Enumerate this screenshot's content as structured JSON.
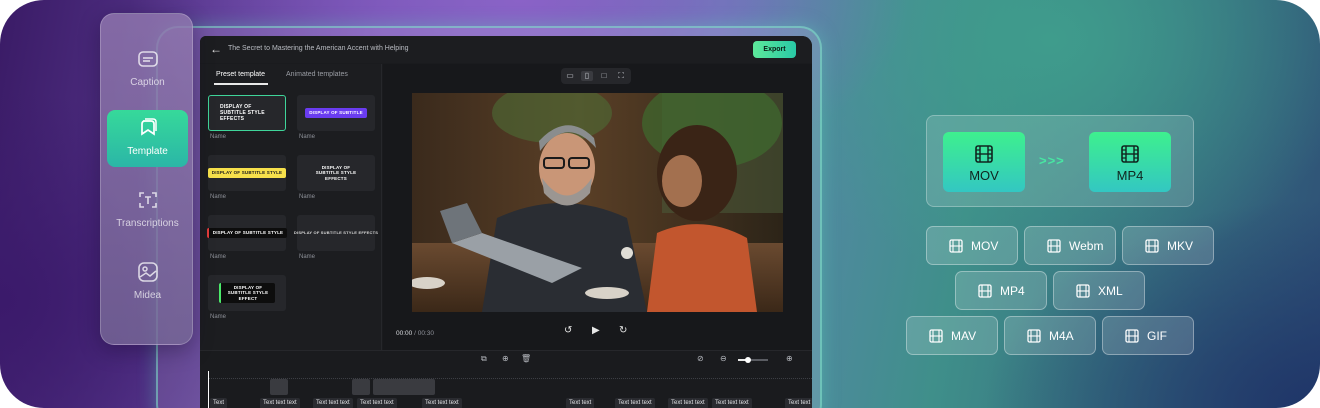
{
  "editor": {
    "title": "The Secret to Mastering the American Accent with Helping",
    "export_label": "Export",
    "tabs": [
      "Preset template",
      "Animated templates"
    ],
    "templates": [
      {
        "text": "DISPLAY OF SUBTITLE STYLE EFFECTS",
        "name": "Name"
      },
      {
        "text": "DISPLAY OF SUBTITLE",
        "name": "Name"
      },
      {
        "text": "DISPLAY OF SUBTITLE STYLE",
        "name": "Name"
      },
      {
        "text": "DISPLAY OF SUBTITLE STYLE EFFECTS",
        "name": "Name"
      },
      {
        "text": "DISPLAY OF SUBTITLE STYLE",
        "name": "Name"
      },
      {
        "text": "DISPLAY OF SUBTITLE STYLE EFFECTS",
        "name": "Name"
      },
      {
        "text": "DISPLAY OF SUBTITLE STYLE EFFECT",
        "name": "Name"
      }
    ],
    "time_current": "00:00",
    "time_total": "/ 00:30",
    "timeline_chips": [
      "Text",
      "Text text text",
      "Text text text",
      "Text text text",
      "Text text text",
      "Text text",
      "Text text text",
      "Text text text",
      "Text text text",
      "Text text"
    ]
  },
  "sidebar": {
    "items": [
      {
        "label": "Caption",
        "icon": "caption-icon"
      },
      {
        "label": "Template",
        "icon": "template-icon"
      },
      {
        "label": "Transcriptions",
        "icon": "transcriptions-icon"
      },
      {
        "label": "Midea",
        "icon": "media-icon"
      }
    ]
  },
  "conversion": {
    "from": "MOV",
    "to": "MP4",
    "arrow": ">>>",
    "formats": [
      "MOV",
      "Webm",
      "MKV",
      "MP4",
      "XML",
      "MAV",
      "M4A",
      "GIF"
    ]
  },
  "colors": {
    "accent_green": "#3ef08e",
    "accent_teal": "#33c7c2",
    "editor_bg": "#1a1b1e"
  }
}
